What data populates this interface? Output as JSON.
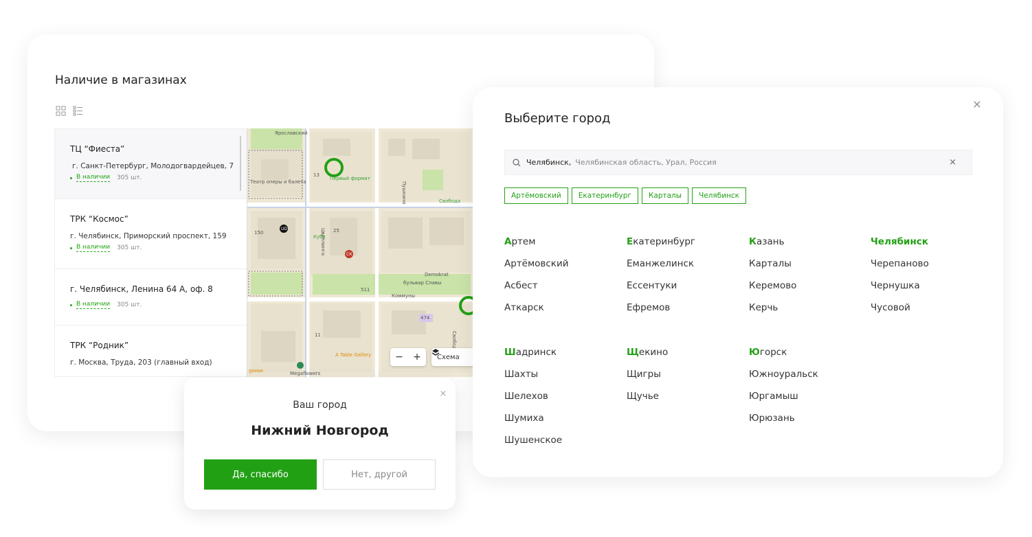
{
  "stores": {
    "title": "Наличие в магазинах",
    "items": [
      {
        "name": "ТЦ “Фиеста”",
        "address": "г. Санкт-Петербург, Молодогвардейцев, 7",
        "status": "В наличии",
        "qty": "305 шт."
      },
      {
        "name": "ТРК “Космос”",
        "address": "г. Челябинск, Приморский проспект, 159",
        "status": "В наличии",
        "qty": "305 шт."
      },
      {
        "name": "г. Челябинск, Ленина 64 А, оф. 8",
        "address": "",
        "status": "В наличии",
        "qty": "305 шт."
      },
      {
        "name": "ТРК “Родник”",
        "address": "г. Москва, Труда, 203 (главный вход)",
        "status": "",
        "qty": ""
      }
    ]
  },
  "map": {
    "labels": {
      "yaroslavsky": "Ярославский",
      "opera": "Театр оперы и балета",
      "first_format": "Первый формат",
      "pushkina": "Пушкина",
      "svoboda": "Свобода",
      "cvillinga": "Цвиллинга",
      "kuba": "Куба",
      "ud": "UD",
      "ck": "СК",
      "demokrat": "Demokrat",
      "boulevard": "бульвар Славы",
      "kommuny": "Коммуны",
      "table_gallery": "A Table Gallery",
      "megaflowers": "Megaflowers",
      "goose": "goose",
      "svoboda_street": "Свобод",
      "n474": "474",
      "n150": "150",
      "n13": "13",
      "n25": "25",
      "n511": "511",
      "n11": "11"
    },
    "zoom_out": "−",
    "zoom_in": "+",
    "scheme_label": "Схема",
    "colors": {
      "marker": "#22a014"
    }
  },
  "confirm": {
    "question": "Ваш город",
    "city": "Нижний Новгород",
    "yes_label": "Да, спасибо",
    "no_label": "Нет, другой",
    "close": "×"
  },
  "city_picker": {
    "title": "Выберите город",
    "close": "×",
    "search": {
      "value": "Челябинск,",
      "hint": "Челябинская область, Урал, Россия",
      "clear": "×"
    },
    "quick": [
      "Артёмовский",
      "Екатеринбург",
      "Карталы",
      "Челябинск"
    ],
    "groups": {
      "a": {
        "head_letter": "А",
        "head_rest": "ртем",
        "items": [
          "Артёмовский",
          "Асбест",
          "Аткарск"
        ]
      },
      "e": {
        "head_letter": "Е",
        "head_rest": "катеринбург",
        "items": [
          "Еманжелинск",
          "Ессентуки",
          "Ефремов"
        ]
      },
      "k": {
        "head_letter": "К",
        "head_rest": "азань",
        "items": [
          "Карталы",
          "Керемово",
          "Керчь"
        ]
      },
      "ch": {
        "head": "Челябинск",
        "items": [
          "Черепаново",
          "Чернушка",
          "Чусовой"
        ]
      },
      "sh": {
        "head_letter": "Ш",
        "head_rest": "адринск",
        "items": [
          "Шахты",
          "Шелехов",
          "Шумиха",
          "Шушенское"
        ]
      },
      "sch": {
        "head_letter": "Щ",
        "head_rest": "екино",
        "items": [
          "Щигры",
          "Щучье"
        ]
      },
      "yu": {
        "head_letter": "Ю",
        "head_rest": "горск",
        "items": [
          "Южноуральск",
          "Юргамыш",
          "Юрюзань"
        ]
      }
    },
    "colors": {
      "accent": "#22a014"
    }
  }
}
